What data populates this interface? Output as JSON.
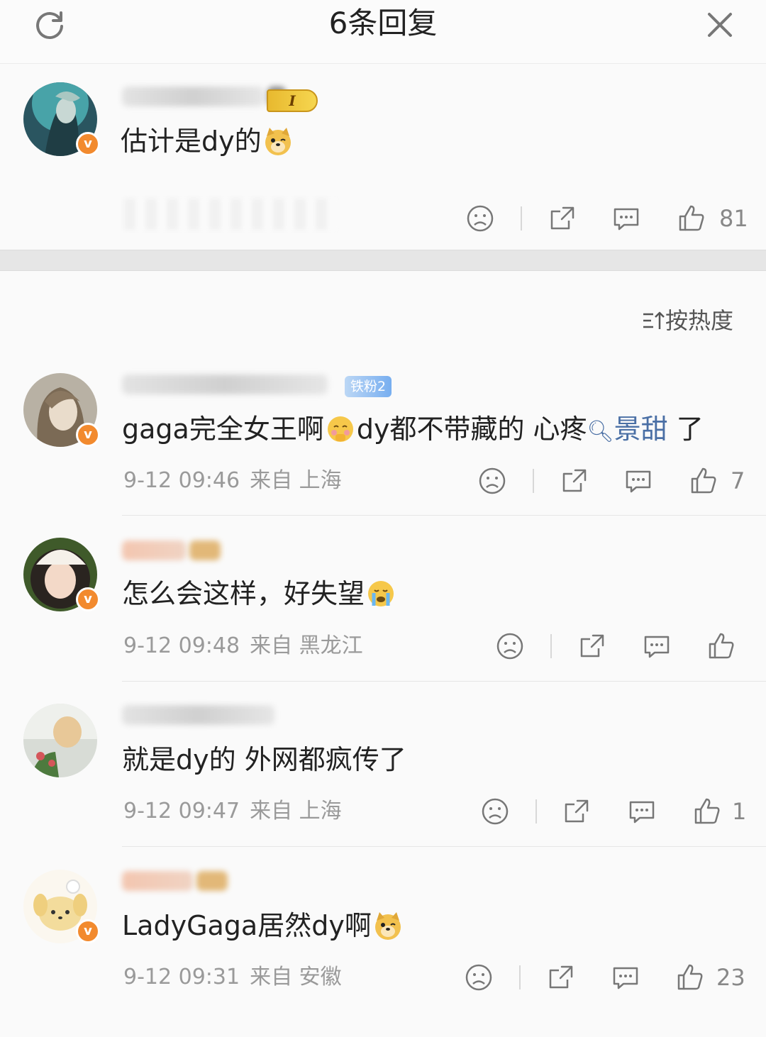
{
  "header": {
    "title": "6条回复"
  },
  "root_comment": {
    "content": "估计是dy的",
    "emoji": "doge-emoji",
    "badge": "I",
    "likes": "81"
  },
  "sort": {
    "label": "按热度"
  },
  "replies": [
    {
      "fan_badge": "铁粉2",
      "content_a": "gaga完全女王啊",
      "emoji_a": "shy-emoji",
      "content_b": "dy都不带藏的 心疼",
      "search_term": "景甜",
      "content_c": " 了",
      "date": "9-12 09:46",
      "source": "来自 上海",
      "likes": "7"
    },
    {
      "content": "怎么会这样，好失望",
      "emoji": "crying-emoji",
      "date": "9-12 09:48",
      "source": "来自 黑龙江",
      "likes": ""
    },
    {
      "content": "就是dy的 外网都疯传了",
      "date": "9-12 09:47",
      "source": "来自 上海",
      "likes": "1"
    },
    {
      "content": "LadyGaga居然dy啊",
      "emoji": "doge-emoji",
      "date": "9-12 09:31",
      "source": "来自 安徽",
      "likes": "23"
    }
  ],
  "icons": {
    "refresh": "refresh-icon",
    "close": "close-icon",
    "dislike": "sad-face-icon",
    "share": "share-icon",
    "comment": "comment-icon",
    "like": "thumbs-up-icon",
    "verified": "verified-v-icon"
  },
  "colors": {
    "verified_badge": "#f28a2e",
    "fan_badge": "#77aef0",
    "link": "#4a6fa5",
    "meta_text": "#9a9a9a"
  }
}
